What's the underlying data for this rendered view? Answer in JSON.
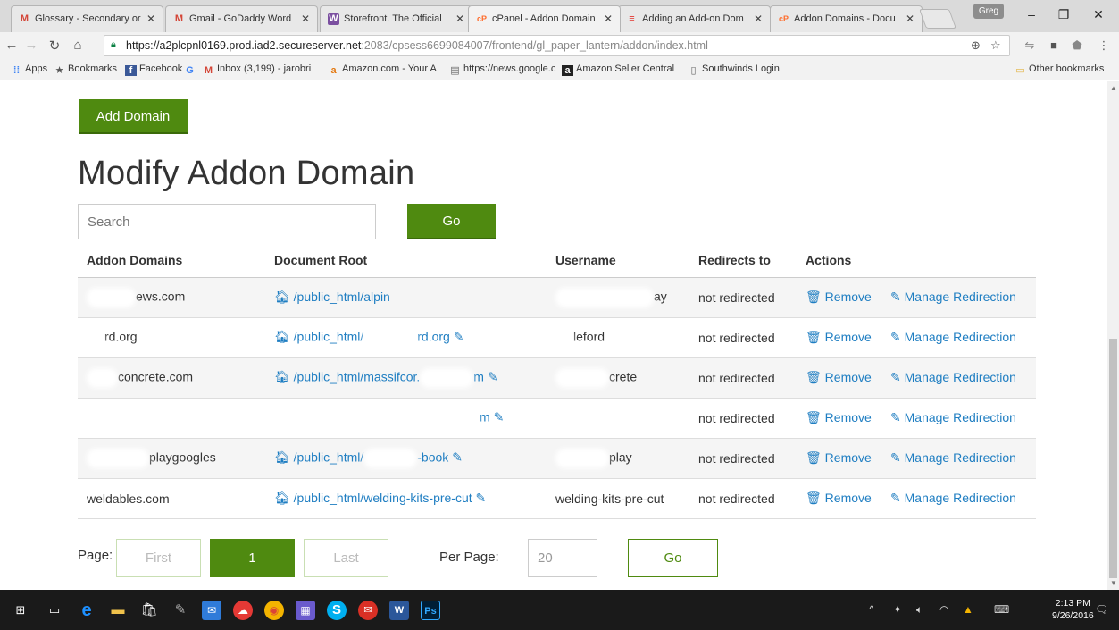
{
  "browser": {
    "tabs": [
      {
        "title": "Glossary - Secondary or",
        "favicon": "M",
        "color": "#d44638"
      },
      {
        "title": "Gmail - GoDaddy Word",
        "favicon": "M",
        "color": "#d44638"
      },
      {
        "title": "Storefront. The Official",
        "favicon": "W",
        "color": "#7b4fa0"
      },
      {
        "title": "cPanel - Addon Domain",
        "favicon": "cP",
        "color": "#ff6c2c"
      },
      {
        "title": "Adding an Add-on Dom",
        "favicon": "≡",
        "color": "#e2342e"
      },
      {
        "title": "Addon Domains - Docu",
        "favicon": "cP",
        "color": "#ff6c2c"
      }
    ],
    "profile_name": "Greg",
    "url_host": "https://a2plcpnl0169.prod.iad2.secureserver.net",
    "url_path": ":2083/cpsess6699084007/frontend/gl_paper_lantern/addon/index.html",
    "bookmarks": [
      {
        "label": "Apps",
        "icon": "apps-icon"
      },
      {
        "label": "Bookmarks",
        "icon": "star-icon"
      },
      {
        "label": "Facebook",
        "icon": "facebook-icon"
      },
      {
        "label": "",
        "icon": "google-icon"
      },
      {
        "label": "Inbox (3,199) - jarobri",
        "icon": "gmail-icon"
      },
      {
        "label": "Amazon.com - Your A",
        "icon": "amazon-icon"
      },
      {
        "label": "https://news.google.c",
        "icon": "news-icon"
      },
      {
        "label": "Amazon Seller Central",
        "icon": "amazon-seller-icon"
      },
      {
        "label": "Southwinds Login",
        "icon": "page-icon"
      }
    ],
    "other_bookmarks": "Other bookmarks"
  },
  "page": {
    "add_domain_label": "Add Domain",
    "title": "Modify Addon Domain",
    "search_placeholder": "Search",
    "search_go": "Go",
    "columns": [
      "Addon Domains",
      "Document Root",
      "Username",
      "Redirects to",
      "Actions"
    ],
    "rows": [
      {
        "domain": "ews.com",
        "docroot": "/public_html/alpin",
        "username": "ay",
        "redirects": "not redirected",
        "edit": false
      },
      {
        "domain": "rd.org",
        "docroot": "/public_html/",
        "docroot_tail": "rd.org",
        "username": "leford",
        "redirects": "not redirected",
        "edit": true
      },
      {
        "domain": "concrete.com",
        "docroot": "/public_html/massifcor.",
        "docroot_tail": "m",
        "username": "crete",
        "redirects": "not redirected",
        "edit": true
      },
      {
        "domain": "",
        "docroot": "",
        "docroot_tail": "m",
        "username": "",
        "redirects": "not redirected",
        "edit": true
      },
      {
        "domain": "playgoogles",
        "docroot": "/public_html/",
        "docroot_tail": "-book",
        "username": "play",
        "redirects": "not redirected",
        "edit": true
      },
      {
        "domain": "weldables.com",
        "docroot": "/public_html/welding-kits-pre-cut",
        "docroot_tail": "",
        "username": "welding-kits-pre-cut",
        "redirects": "not redirected",
        "edit": true
      }
    ],
    "remove_label": "Remove",
    "manage_label": "Manage Redirection",
    "pager": {
      "page_label": "Page:",
      "first": "First",
      "current": "1",
      "last": "Last",
      "per_page_label": "Per Page:",
      "per_page_value": "20",
      "go": "Go"
    }
  },
  "taskbar": {
    "time": "2:13 PM",
    "date": "9/26/2016"
  },
  "colors": {
    "accent_green": "#4f8a10",
    "link_blue": "#1f7ec2"
  }
}
